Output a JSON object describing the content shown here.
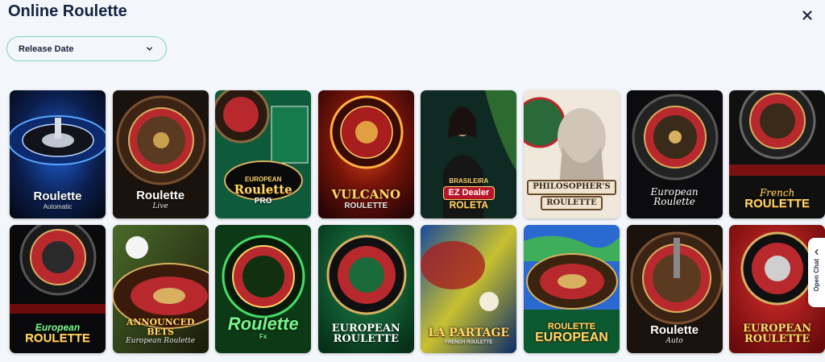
{
  "header": {
    "title": "Online Roulette"
  },
  "sort": {
    "value": "Release Date"
  },
  "chat": {
    "label": "Open Chat"
  },
  "icons": [
    "close-icon",
    "chevron-down-icon",
    "chevron-left-icon"
  ],
  "colors": {
    "accent": "#7fd6b9",
    "background": "#f3f6fb",
    "title": "#10233f"
  },
  "games": [
    {
      "title": "Roulette",
      "subtitle": "Automatic"
    },
    {
      "title": "Roulette",
      "subtitle": "Live"
    },
    {
      "title": "Roulette",
      "subtitle": "PRO",
      "top": "EUROPEAN"
    },
    {
      "title": "VULCANO",
      "subtitle": "ROULETTE"
    },
    {
      "title": "EZ Dealer",
      "subtitle": "ROLETA",
      "top": "BRASILEIRA"
    },
    {
      "title": "PHILOSOPHER'S",
      "subtitle": "ROULETTE"
    },
    {
      "title": "European Roulette",
      "subtitle": ""
    },
    {
      "title": "ROULETTE",
      "subtitle": "",
      "top": "French"
    },
    {
      "title": "ROULETTE",
      "subtitle": "",
      "top": "European"
    },
    {
      "title": "ANNOUNCED BETS",
      "subtitle": "European Roulette"
    },
    {
      "title": "Roulette",
      "subtitle": "",
      "top": "Fx"
    },
    {
      "title": "EUROPEAN",
      "subtitle": "ROULETTE"
    },
    {
      "title": "LA PARTAGE",
      "subtitle": "FRENCH ROULETTE"
    },
    {
      "title": "EUROPEAN",
      "subtitle": "",
      "top": "ROULETTE"
    },
    {
      "title": "Roulette",
      "subtitle": "Auto"
    },
    {
      "title": "EUROPEAN",
      "subtitle": "ROULETTE"
    }
  ]
}
